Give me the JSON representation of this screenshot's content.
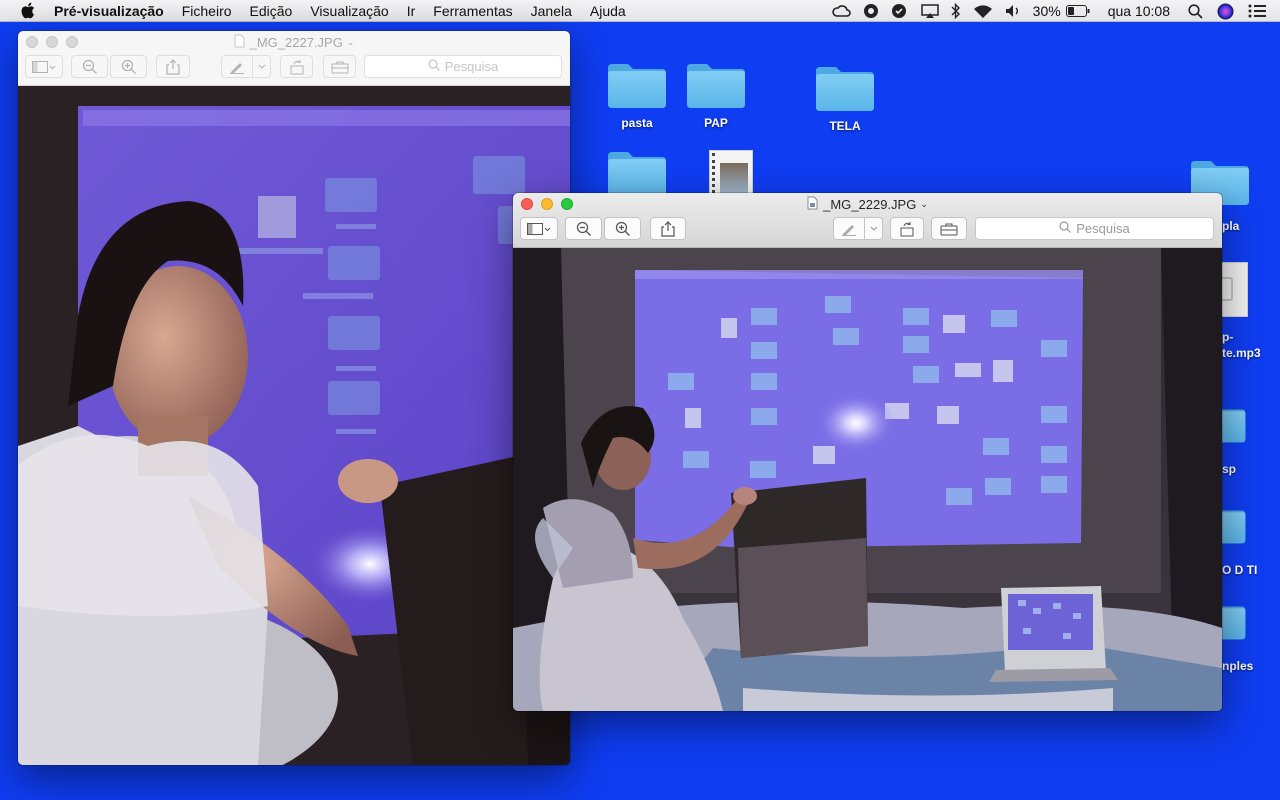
{
  "menubar": {
    "apple_icon": "apple-icon",
    "items": [
      "Pré-visualização",
      "Ficheiro",
      "Edição",
      "Visualização",
      "Ir",
      "Ferramentas",
      "Janela",
      "Ajuda"
    ],
    "battery_percent": "30%",
    "clock": "qua 10:08"
  },
  "desktop": {
    "background_color": "#0f3df2",
    "icons": [
      "pasta",
      "PAP",
      "TELA",
      "pla",
      "p-",
      "te.mp3",
      "sp",
      "O D TI",
      "nples"
    ]
  },
  "window_back": {
    "title": "_MG_2227.JPG",
    "search_placeholder": "Pesquisa"
  },
  "window_front": {
    "title": "_MG_2229.JPG",
    "search_placeholder": "Pesquisa"
  },
  "colors": {
    "accent": "#0f3df2",
    "close": "#fc5f57",
    "minimize": "#fdbc2e",
    "zoom": "#29c940"
  }
}
